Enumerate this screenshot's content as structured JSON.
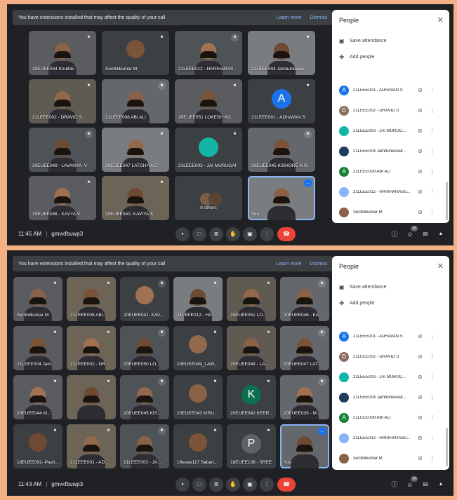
{
  "colors": {
    "page_bg": "#f2b084",
    "meet_bg": "#202124",
    "tile_bg": "#3c4043",
    "accent_blue": "#8ab4f8",
    "end_call_red": "#ea4335"
  },
  "screens": [
    {
      "banner": {
        "message": "You have extensions installed that may affect the quality of your call",
        "learn_more": "Learn more",
        "dismiss": "Dismiss"
      },
      "tiles": [
        {
          "name": "20EUEE044 Kiruthik",
          "kind": "video"
        },
        {
          "name": "Senthilkumar M",
          "kind": "photo"
        },
        {
          "name": "21LEEE012 - HARIHARAS...",
          "kind": "video"
        },
        {
          "name": "21LEEE004 Jambuheswa...",
          "kind": "video"
        },
        {
          "name": "21LEEE002 - DRAVID S",
          "kind": "video"
        },
        {
          "name": "21LEEE008 ABI ALI",
          "kind": "video"
        },
        {
          "name": "20EUEE051 LOKESH KU...",
          "kind": "video"
        },
        {
          "name": "21LEEE001 - ADHAVAN S",
          "kind": "avatar",
          "letter": "A",
          "color": "#1a73e8"
        },
        {
          "name": "20EUEE048 - LAVANYA. V",
          "kind": "video"
        },
        {
          "name": "20EUEE047 LATCHIYA D",
          "kind": "video"
        },
        {
          "name": "21LEEE003 - JAI MURUGAN",
          "kind": "avatar",
          "letter": "",
          "color": "#12b5a6"
        },
        {
          "name": "20EUEE045 KISHORE N R",
          "kind": "video"
        },
        {
          "name": "20EUEE046 - KAVYA V",
          "kind": "video"
        },
        {
          "name": "20EUEE040- KAVIYA S",
          "kind": "video"
        },
        {
          "name": "8 others",
          "kind": "others"
        },
        {
          "name": "You",
          "kind": "you"
        }
      ],
      "controls": {
        "time": "11:45 AM",
        "meeting_code": "gmvxfbuwp3",
        "people_count": "29"
      },
      "panel": {
        "title": "People",
        "save_attendance": "Save attendance",
        "add_people": "Add people",
        "participants": [
          {
            "name": "21LEEE001 - ADHAVAN S",
            "letter": "A",
            "color": "#1a73e8"
          },
          {
            "name": "21LEEE002 - DRAVID S",
            "letter": "D",
            "color": "#8d6e63"
          },
          {
            "name": "21LEEE003 - JAI MURUG...",
            "letter": "",
            "color": "#12b5a6"
          },
          {
            "name": "21LEEE004 Jambuheswar...",
            "letter": "",
            "color": "#1e3a5f"
          },
          {
            "name": "21LEEE008 ABI ALI",
            "letter": "A",
            "color": "#188038"
          },
          {
            "name": "21LEEE012 - HARIHARASU...",
            "letter": "",
            "color": "#8ab4f8"
          },
          {
            "name": "Senthilkumar M",
            "letter": "",
            "color": "#8a6248"
          }
        ]
      }
    },
    {
      "banner": {
        "message": "You have extensions installed that may affect the quality of your call",
        "learn_more": "Learn more",
        "dismiss": "Dismiss"
      },
      "tiles": [
        {
          "name": "Senthilkumar M",
          "kind": "video"
        },
        {
          "name": "21LEEE008 ABI...",
          "kind": "video"
        },
        {
          "name": "20EUEE041- KAV...",
          "kind": "photo"
        },
        {
          "name": "21LEEE012 - HA...",
          "kind": "video"
        },
        {
          "name": "20EUEE051 LO...",
          "kind": "video"
        },
        {
          "name": "20EUEE046 - KA...",
          "kind": "video"
        },
        {
          "name": "21LEEE004 Jam...",
          "kind": "video"
        },
        {
          "name": "21LEEE002 - DR...",
          "kind": "video"
        },
        {
          "name": "20EUEE050 LO...",
          "kind": "video"
        },
        {
          "name": "20EUEE049_LAW...",
          "kind": "photo"
        },
        {
          "name": "20EUEE048 - LA...",
          "kind": "video"
        },
        {
          "name": "20EUEE047 LAT...",
          "kind": "video"
        },
        {
          "name": "20EUEE044 Ki...",
          "kind": "video"
        },
        {
          "name": "...",
          "kind": "video"
        },
        {
          "name": "20EUEE045 KIS...",
          "kind": "video"
        },
        {
          "name": "20EUEE043 KIRU...",
          "kind": "photo"
        },
        {
          "name": "20EUEE042 KEER...",
          "kind": "avatar",
          "letter": "K",
          "color": "#0b6e4f"
        },
        {
          "name": "20EUEE039 - M...",
          "kind": "video"
        },
        {
          "name": "18EUEE091- Pavit...",
          "kind": "photo"
        },
        {
          "name": "21LEEE001 - AD...",
          "kind": "video"
        },
        {
          "name": "21LEEE003 - JA...",
          "kind": "video"
        },
        {
          "name": "18euее117 Sabari...",
          "kind": "photo"
        },
        {
          "name": "18EUEE136 - SREE...",
          "kind": "avatar",
          "letter": "P",
          "color": "#5f6368"
        },
        {
          "name": "You",
          "kind": "you"
        }
      ],
      "controls": {
        "time": "11:43 AM",
        "meeting_code": "gmvxfbuwp3",
        "people_count": "24"
      },
      "panel": {
        "title": "People",
        "save_attendance": "Save attendance",
        "add_people": "Add people",
        "participants": [
          {
            "name": "21LEEE001 - ADHAVAN S",
            "letter": "A",
            "color": "#1a73e8"
          },
          {
            "name": "21LEEE002 - DRAVID S",
            "letter": "D",
            "color": "#8d6e63"
          },
          {
            "name": "21LEEE003 - JAI MURUG...",
            "letter": "",
            "color": "#12b5a6"
          },
          {
            "name": "21LEEE004 Jambuheswar...",
            "letter": "",
            "color": "#1e3a5f"
          },
          {
            "name": "21LEEE008 ABI ALI",
            "letter": "A",
            "color": "#188038"
          },
          {
            "name": "21LEEE012 - HARIHARASU...",
            "letter": "",
            "color": "#8ab4f8"
          },
          {
            "name": "Senthilkumar M",
            "letter": "",
            "color": "#8a6248"
          }
        ]
      }
    }
  ]
}
